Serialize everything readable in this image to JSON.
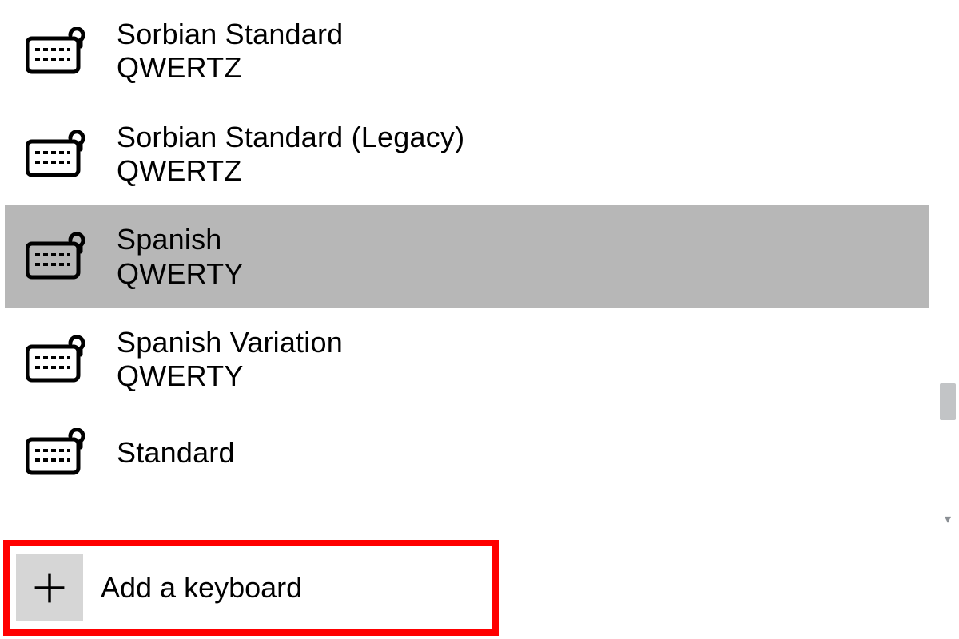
{
  "layouts": [
    {
      "name": "Sorbian Standard",
      "layout": "QWERTZ",
      "selected": false
    },
    {
      "name": "Sorbian Standard (Legacy)",
      "layout": "QWERTZ",
      "selected": false
    },
    {
      "name": "Spanish",
      "layout": "QWERTY",
      "selected": true
    },
    {
      "name": "Spanish Variation",
      "layout": "QWERTY",
      "selected": false
    },
    {
      "name": "Standard",
      "layout": "",
      "selected": false
    }
  ],
  "add_button": {
    "label": "Add a keyboard"
  },
  "icons": {
    "keyboard": "keyboard-icon",
    "plus": "plus-icon"
  },
  "colors": {
    "highlight": "#ff0000",
    "selected_bg": "#b7b7b7",
    "plus_bg": "#d6d6d6"
  }
}
